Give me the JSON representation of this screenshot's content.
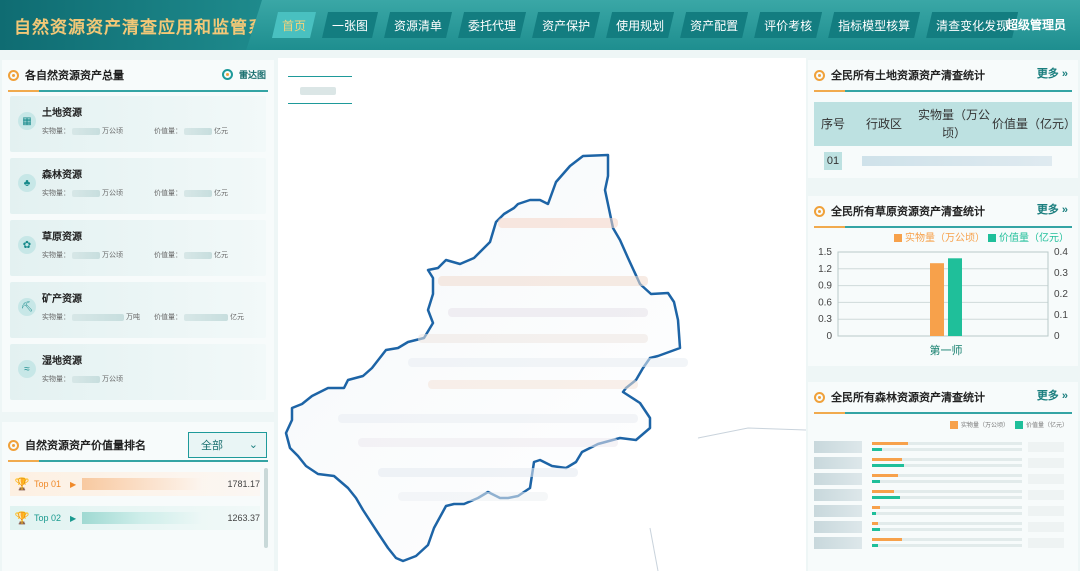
{
  "header": {
    "title": "自然资源资产清查应用和监管系统",
    "nav": [
      "首页",
      "一张图",
      "资源清单",
      "委托代理",
      "资产保护",
      "使用规划",
      "资产配置",
      "评价考核",
      "指标模型核算",
      "清查变化发现"
    ],
    "active_index": 0,
    "user": "超级管理员"
  },
  "left": {
    "totals_title": "各自然资源资产总量",
    "radar_label": "雷达图",
    "resources": [
      {
        "name": "土地资源",
        "qty_label": "实物量：",
        "qty_unit": "万公顷",
        "val_label": "价值量：",
        "val_unit": "亿元",
        "icon": "land-icon"
      },
      {
        "name": "森林资源",
        "qty_label": "实物量：",
        "qty_unit": "万公顷",
        "val_label": "价值量：",
        "val_unit": "亿元",
        "icon": "forest-icon"
      },
      {
        "name": "草原资源",
        "qty_label": "实物量：",
        "qty_unit": "万公顷",
        "val_label": "价值量：",
        "val_unit": "亿元",
        "icon": "grass-icon"
      },
      {
        "name": "矿产资源",
        "qty_label": "实物量：",
        "qty_unit": "万吨",
        "val_label": "价值量：",
        "val_unit": "亿元",
        "icon": "mineral-icon"
      },
      {
        "name": "湿地资源",
        "qty_label": "实物量：",
        "qty_unit": "万公顷",
        "val_label": "",
        "val_unit": "",
        "icon": "wetland-icon"
      }
    ],
    "ranking_title": "自然资源资产价值量排名",
    "ranking_filter": "全部",
    "ranking": [
      {
        "label": "Top 01",
        "value": "1781.17"
      },
      {
        "label": "Top 02",
        "value": "1263.37"
      }
    ]
  },
  "right": {
    "land_title": "全民所有土地资源资产清查统计",
    "more": "更多",
    "land_headers": [
      "序号",
      "行政区",
      "实物量（万公顷）",
      "价值量（亿元）"
    ],
    "land_row_no": "01",
    "grass_title": "全民所有草原资源资产清查统计",
    "forest_title": "全民所有森林资源资产清查统计",
    "forest_legend": [
      "实物量（万公顷）",
      "价值量（亿元）"
    ]
  },
  "chart_data": {
    "type": "bar",
    "categories": [
      "第一师"
    ],
    "series": [
      {
        "name": "实物量（万公顷）",
        "values": [
          1.3
        ],
        "axis": "left",
        "color": "#f7a14b"
      },
      {
        "name": "价值量（亿元）",
        "values": [
          0.37
        ],
        "axis": "right",
        "color": "#1fbf9a"
      }
    ],
    "ylim_left": [
      0,
      1.5
    ],
    "yticks_left": [
      "1.5",
      "1.2",
      "0.9",
      "0.6",
      "0.3",
      "0"
    ],
    "ylim_right": [
      0,
      0.4
    ],
    "yticks_right": [
      "0.4",
      "0.3",
      "0.2",
      "0.1",
      "0"
    ],
    "grid": true,
    "legend": "top"
  },
  "colors": {
    "accent": "#1e9a9a",
    "brand_text": "#f3c877",
    "orange": "#f7a14b",
    "green": "#1fbf9a"
  }
}
